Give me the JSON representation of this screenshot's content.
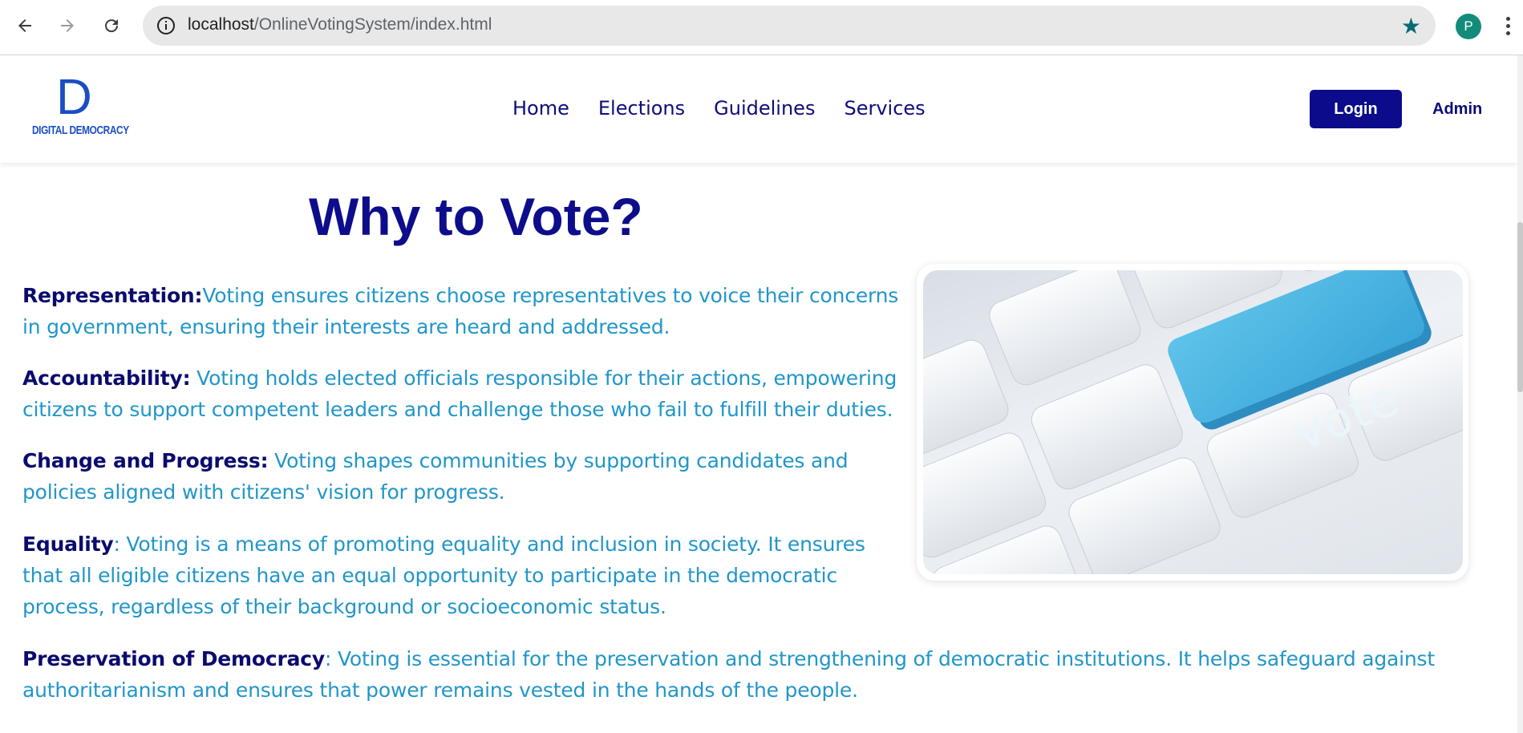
{
  "browser": {
    "url_host": "localhost",
    "url_path": "/OnlineVotingSystem/index.html",
    "profile_initial": "P",
    "star_color": "#0b6b74"
  },
  "site": {
    "logo_letter": "D",
    "logo_text": "DIGITAL DEMOCRACY",
    "nav": [
      "Home",
      "Elections",
      "Guidelines",
      "Services"
    ],
    "login_label": "Login",
    "admin_label": "Admin",
    "brand_color": "#0b0b8c"
  },
  "content": {
    "heading": "Why to Vote?",
    "image_label": "vote",
    "points": [
      {
        "title": "Representation:",
        "text": "Voting ensures citizens choose representatives to voice their concerns in government, ensuring their interests are heard and addressed."
      },
      {
        "title": "Accountability:",
        "text": " Voting holds elected officials responsible for their actions, empowering citizens to support competent leaders and challenge those who fail to fulfill their duties."
      },
      {
        "title": "Change and Progress:",
        "text": " Voting shapes communities by supporting candidates and policies aligned with citizens' vision for progress."
      },
      {
        "title": "Equality",
        "text": ": Voting is a means of promoting equality and inclusion in society. It ensures that all eligible citizens have an equal opportunity to participate in the democratic process, regardless of their background or socioeconomic status."
      },
      {
        "title": "Preservation of Democracy",
        "text": ": Voting is essential for the preservation and strengthening of democratic institutions. It helps safeguard against authoritarianism and ensures that power remains vested in the hands of the people."
      }
    ]
  }
}
